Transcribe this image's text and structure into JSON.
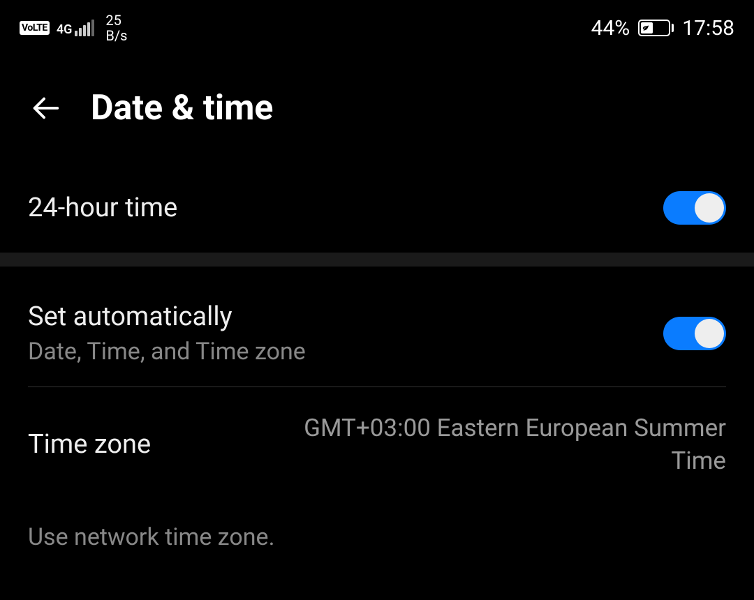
{
  "status_bar": {
    "volte": "VoLTE",
    "network_type": "4G",
    "data_rate_value": "25",
    "data_rate_unit": "B/s",
    "battery_percent": "44%",
    "time": "17:58"
  },
  "header": {
    "title": "Date & time"
  },
  "settings": {
    "twenty_four_hour": {
      "label": "24-hour time",
      "enabled": true
    },
    "set_automatically": {
      "label": "Set automatically",
      "sublabel": "Date, Time, and Time zone",
      "enabled": true
    },
    "timezone": {
      "label": "Time zone",
      "value": "GMT+03:00 Eastern European Summer Time"
    },
    "hint": "Use network time zone."
  }
}
